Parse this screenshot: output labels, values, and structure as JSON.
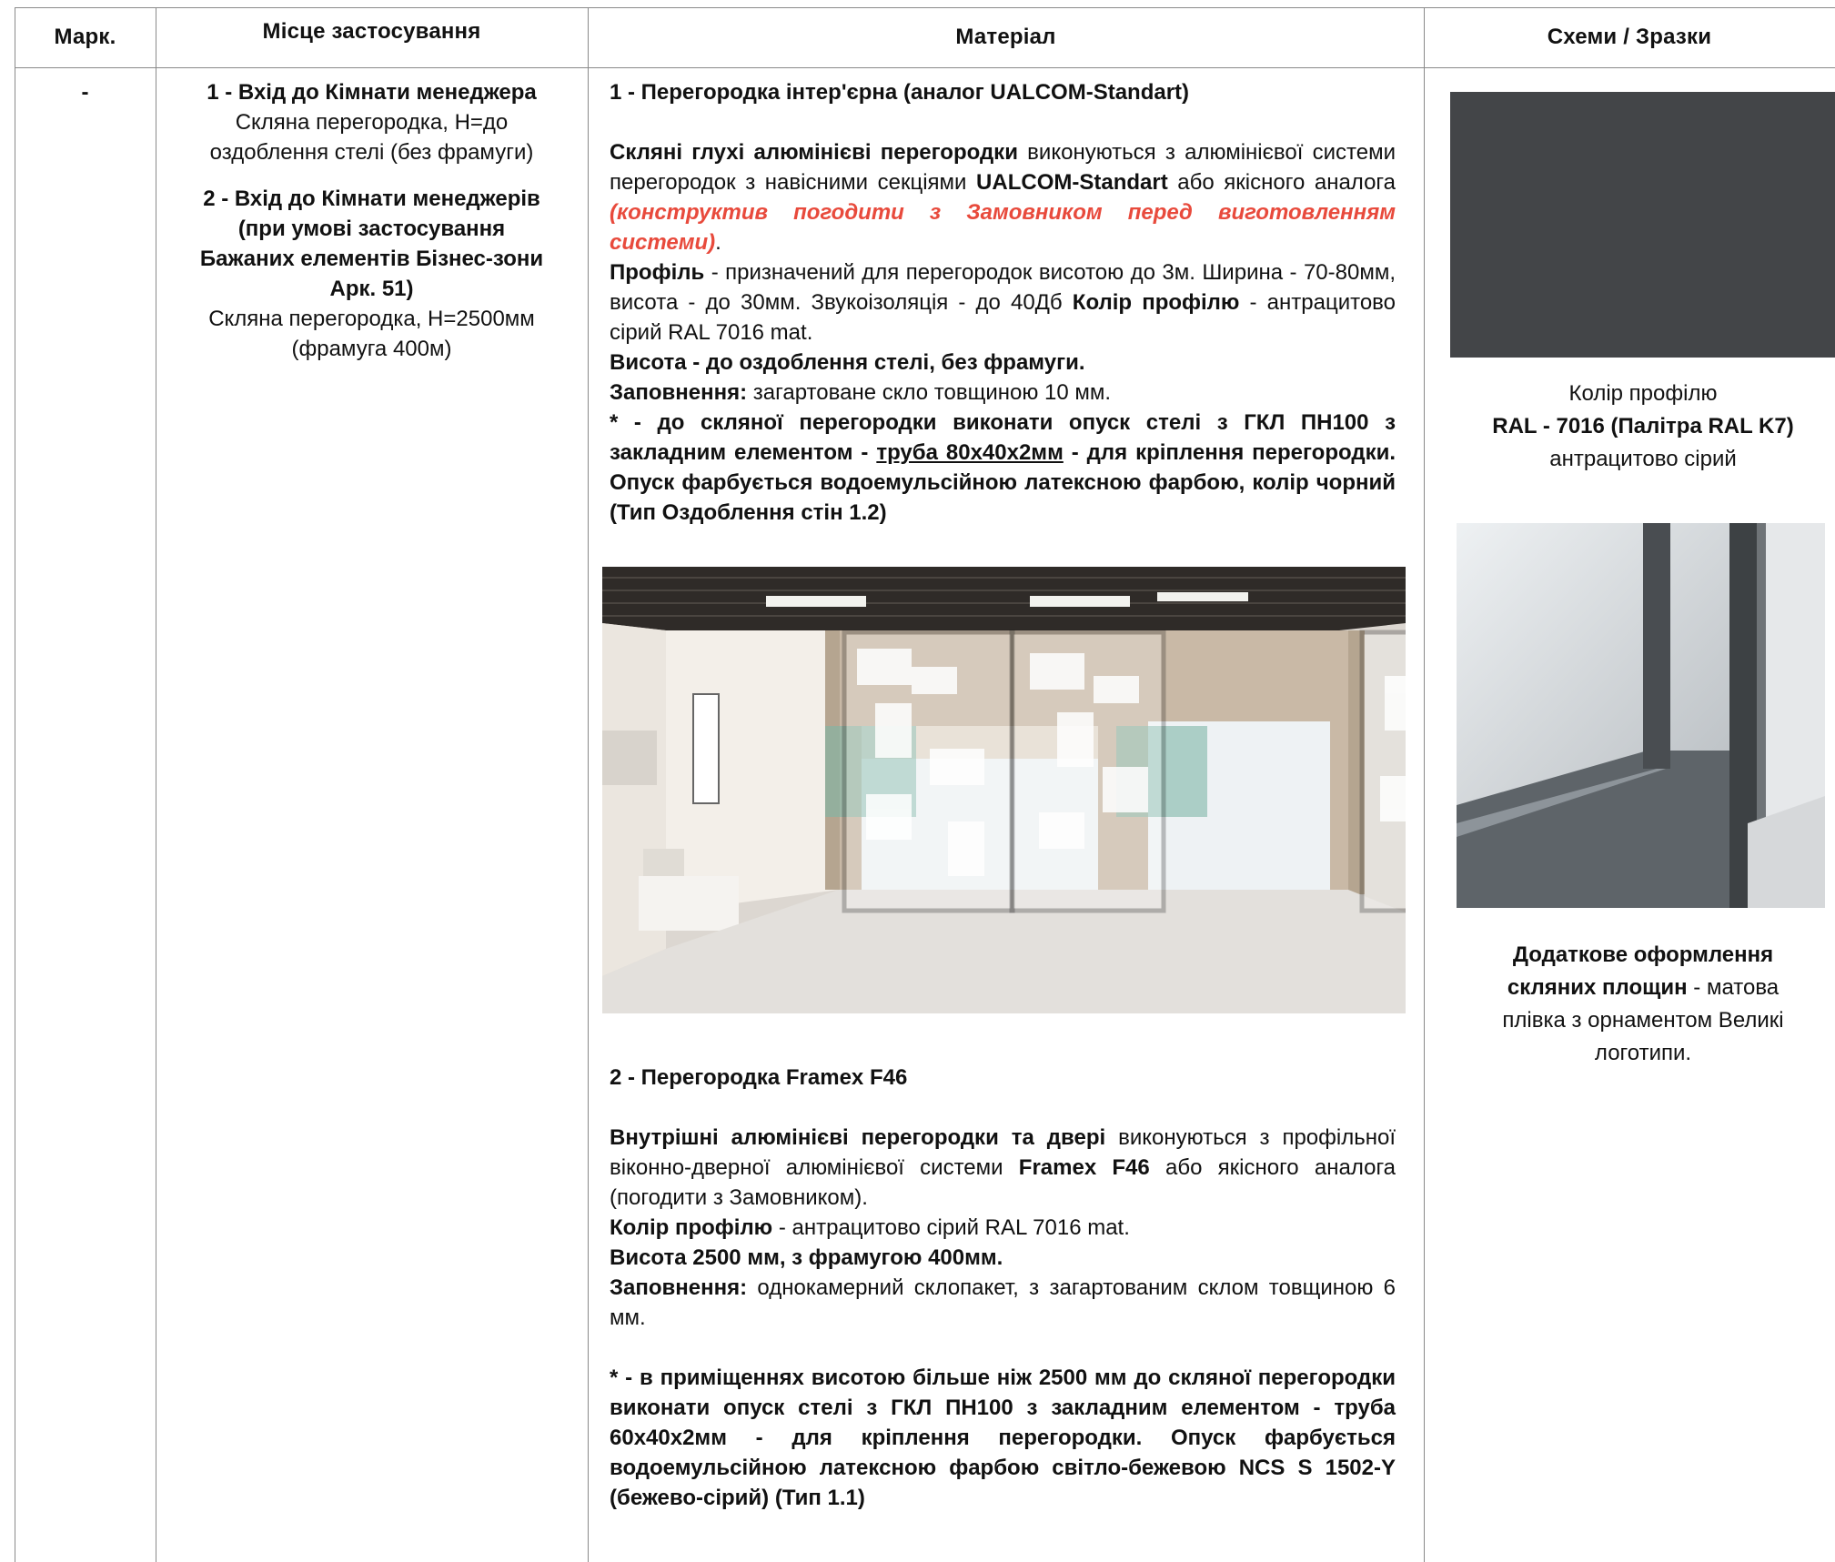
{
  "table": {
    "headers": [
      "Марк.",
      "Місце застосування",
      "Матеріал",
      "Схеми / Зразки"
    ]
  },
  "row": {
    "mark": "-",
    "place": {
      "p1_title": "1 - Вхід до Кімнати менеджера",
      "p1_line1": "Скляна перегородка, Н=до",
      "p1_line2": "оздоблення стелі (без фрамуги)",
      "p2_title_l1": "2 - Вхід до Кімнати менеджерів",
      "p2_title_l2": "(при умові застосування",
      "p2_title_l3": "Бажаних елементів Бізнес-зони",
      "p2_title_l4": "Арк. 51)",
      "p2_line1": "Скляна перегородка, Н=2500мм",
      "p2_line2": "(фрамуга 400м)"
    },
    "material": {
      "s1_title": "1 - Перегородка інтер'єрна (аналог UALCOM-Standart)",
      "s1_a_bold": "Скляні глухі алюмінієві перегородки",
      "s1_a_text1": " виконуються з алюмінієвої системи перегородок з навісними секціями ",
      "s1_a_bold2": "UALCOM-Standart",
      "s1_a_text2": " або якісного аналога ",
      "s1_a_red": "(конструктив погодити з Замовником перед виготовленням системи)",
      "s1_a_end": ".",
      "s1_b_bold": "Профіль",
      "s1_b_text": " - призначений для перегородок висотою до 3м. Ширина - 70-80мм, висота - до 30мм. Звукоізоляція - до 40Дб ",
      "s1_b_bold2": "Колір профілю",
      "s1_b_text2": " - антрацитово сірий RAL 7016 mat.",
      "s1_c": "Висота - до оздоблення стелі, без фрамуги.",
      "s1_d_bold": "Заповнення:",
      "s1_d_text": " загартоване скло товщиною 10 мм.",
      "s1_e_text1": "*  - до скляної перегородки виконати опуск стелі з ГКЛ ПН100 з закладним елементом - ",
      "s1_e_u": "труба 80х40х2мм",
      "s1_e_text2": " - для кріплення перегородки. Опуск фарбується водоемульсійною латексною фарбою, колір чорний (Тип Оздоблення стін 1.2)",
      "s2_title": "2 - Перегородка Framex F46",
      "s2_a_bold": "Внутрішні алюмінієві перегородки та двері",
      "s2_a_text1": " виконуються з профільної віконно-дверної алюмінієвої системи ",
      "s2_a_bold2": "Framex F46",
      "s2_a_text2": "  або якісного аналога (погодити з Замовником).",
      "s2_b_bold": "Колір профілю",
      "s2_b_text": " - антрацитово сірий RAL 7016 mat.",
      "s2_c": "Висота 2500 мм, з фрамугою 400мм.",
      "s2_d_bold": "Заповнення:",
      "s2_d_text": " однокамерний склопакет, з загартованим склом товщиною 6 мм.",
      "s2_e": "*  - в приміщеннях висотою більше ніж 2500 мм до скляної перегородки виконати опуск стелі з ГКЛ ПН100 з закладним елементом - труба 60х40х2мм - для кріплення перегородки. Опуск фарбується водоемульсійною латексною фарбою світло-бежевою NCS S 1502-Y (бежево-сірий) (Тип 1.1)"
    },
    "samples": {
      "swatch_color": "#434548",
      "caption1_l1": "Колір профілю",
      "caption1_l2": "RAL - 7016 (Палітра RAL K7)",
      "caption1_l3": "антрацитово сірий",
      "caption2_bold_l1": "Додаткове оформлення",
      "caption2_bold_l2": "скляних площин",
      "caption2_text_l2": " - матова",
      "caption2_l3": "плівка з орнаментом Великі",
      "caption2_l4": "логотипи."
    }
  }
}
